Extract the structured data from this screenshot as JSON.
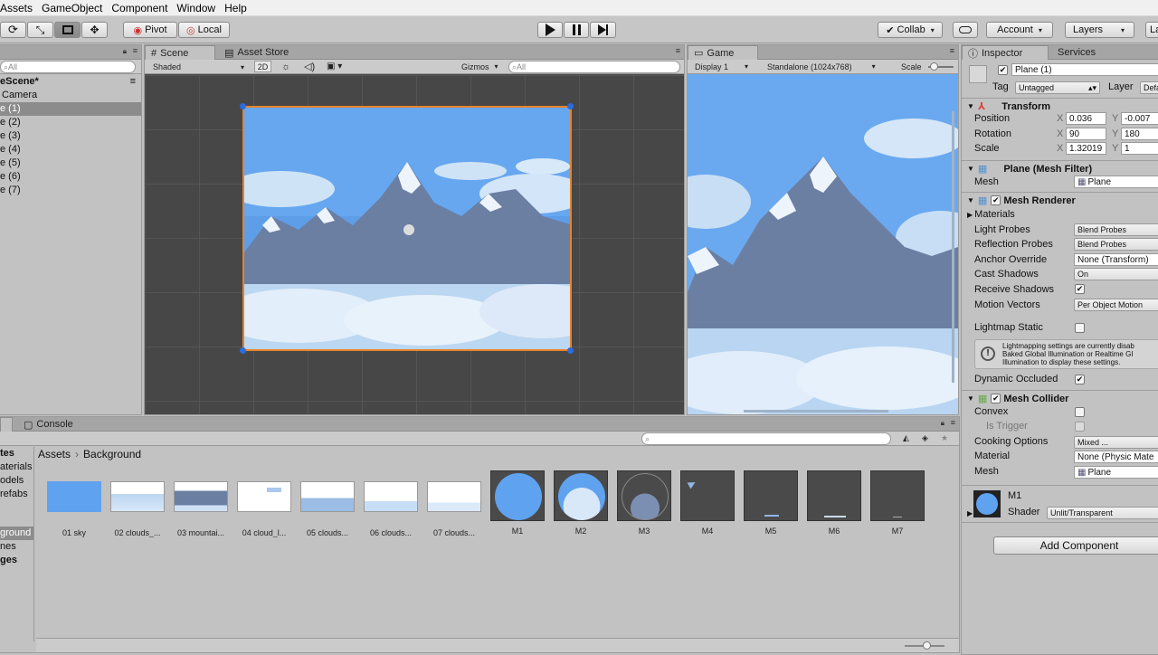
{
  "menu": [
    "Assets",
    "GameObject",
    "Component",
    "Window",
    "Help"
  ],
  "toolbar": {
    "pivot": "Pivot",
    "local": "Local",
    "collab": "Collab",
    "account": "Account",
    "layers": "Layers",
    "layout": "La"
  },
  "hierarchy": {
    "search_placeholder": "All",
    "scene": "eScene*",
    "items": [
      "Camera",
      "e (1)",
      "e (2)",
      "e (3)",
      "e (4)",
      "e (5)",
      "e (6)",
      "e (7)"
    ],
    "selected_index": 1
  },
  "scene": {
    "tab": "Scene",
    "tab2": "Asset Store",
    "shading": "Shaded",
    "mode2d": "2D",
    "gizmos": "Gizmos",
    "search_placeholder": "All"
  },
  "game": {
    "tab": "Game",
    "display": "Display 1",
    "resolution": "Standalone (1024x768)",
    "scale_label": "Scale"
  },
  "inspector": {
    "tab": "Inspector",
    "tab2": "Services",
    "object_name": "Plane (1)",
    "tag_label": "Tag",
    "tag_value": "Untagged",
    "layer_label": "Layer",
    "layer_value": "Defa",
    "transform": {
      "title": "Transform",
      "position_label": "Position",
      "rotation_label": "Rotation",
      "scale_label": "Scale",
      "x_label": "X",
      "y_label": "Y",
      "position_x": "0.036",
      "position_y": "-0.007",
      "rotation_x": "90",
      "rotation_y": "180",
      "scale_x": "1.32019",
      "scale_y": "1"
    },
    "mesh_filter": {
      "title": "Plane (Mesh Filter)",
      "mesh_label": "Mesh",
      "mesh_value": "Plane"
    },
    "mesh_renderer": {
      "title": "Mesh Renderer",
      "materials_label": "Materials",
      "light_probes_label": "Light Probes",
      "light_probes_value": "Blend Probes",
      "reflection_probes_label": "Reflection Probes",
      "reflection_probes_value": "Blend Probes",
      "anchor_override_label": "Anchor Override",
      "anchor_override_value": "None (Transform)",
      "cast_shadows_label": "Cast Shadows",
      "cast_shadows_value": "On",
      "receive_shadows_label": "Receive Shadows",
      "motion_vectors_label": "Motion Vectors",
      "motion_vectors_value": "Per Object Motion",
      "lightmap_static_label": "Lightmap Static",
      "info_line1": "Lightmapping settings are currently disab",
      "info_line2": "Baked Global Illumination or Realtime GI",
      "info_line3": "Illumination to display these settings.",
      "dynamic_occluded_label": "Dynamic Occluded"
    },
    "mesh_collider": {
      "title": "Mesh Collider",
      "convex_label": "Convex",
      "is_trigger_label": "Is Trigger",
      "cooking_label": "Cooking Options",
      "cooking_value": "Mixed ...",
      "material_label": "Material",
      "material_value": "None (Physic Mate",
      "mesh_label": "Mesh",
      "mesh_value": "Plane"
    },
    "material": {
      "name": "M1",
      "shader_label": "Shader",
      "shader_value": "Unlit/Transparent"
    },
    "add_component": "Add Component"
  },
  "project": {
    "tab": "Console",
    "breadcrumb": [
      "Assets",
      "Background"
    ],
    "folders": [
      "tes",
      "aterials",
      "odels",
      "refabs",
      "ground",
      "nes",
      "ges"
    ],
    "selected_folder_index": 4,
    "assets": [
      "01 sky",
      "02 clouds_...",
      "03 mountai...",
      "04 cloud_l...",
      "05 clouds...",
      "06 clouds...",
      "07 clouds...",
      "M1",
      "M2",
      "M3",
      "M4",
      "M5",
      "M6",
      "M7"
    ]
  }
}
